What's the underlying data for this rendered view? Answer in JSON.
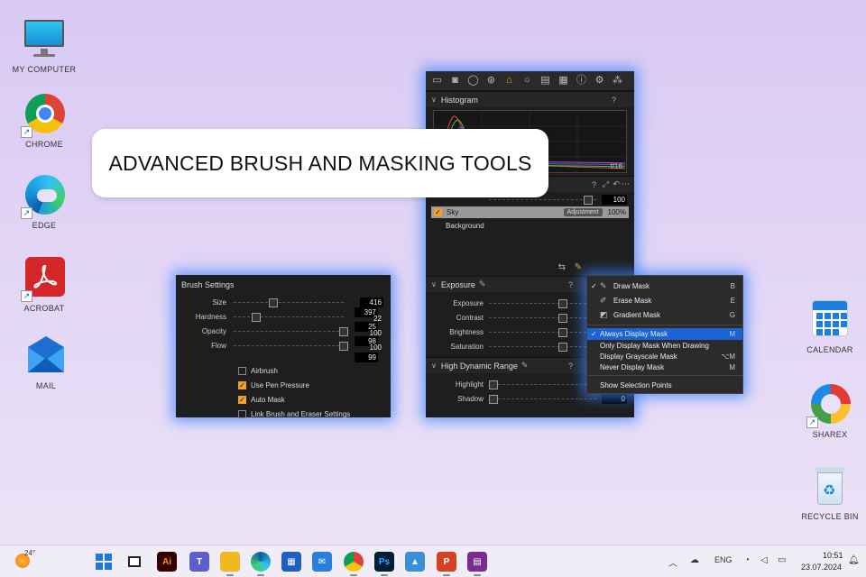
{
  "desktop": {
    "icons_left": [
      {
        "label": "MY COMPUTER",
        "icon": "monitor-icon"
      },
      {
        "label": "CHROME",
        "icon": "chrome-icon"
      },
      {
        "label": "EDGE",
        "icon": "edge-icon"
      },
      {
        "label": "ACROBAT",
        "icon": "acrobat-icon"
      },
      {
        "label": "MAIL",
        "icon": "mail-icon"
      }
    ],
    "icons_right": [
      {
        "label": "CALENDAR",
        "icon": "calendar-icon"
      },
      {
        "label": "SHAREX",
        "icon": "sharex-icon"
      },
      {
        "label": "RECYCLE BIN",
        "icon": "recycle-bin-icon"
      }
    ]
  },
  "banner": {
    "text": "ADVANCED BRUSH AND MASKING TOOLS"
  },
  "main_panel": {
    "histogram": {
      "title": "Histogram",
      "help": "?",
      "aperture": "f/16"
    },
    "layers": {
      "help": "?",
      "opacity_value": "100",
      "items": [
        {
          "name": "Sky",
          "badge": "Adjustment",
          "value": "100%",
          "checked": true
        },
        {
          "name": "Background"
        }
      ]
    },
    "exposure": {
      "title": "Exposure",
      "help": "?",
      "sliders": [
        {
          "name": "Exposure"
        },
        {
          "name": "Contrast"
        },
        {
          "name": "Brightness"
        },
        {
          "name": "Saturation"
        }
      ]
    },
    "hdr": {
      "title": "High Dynamic Range",
      "help": "?",
      "sliders": [
        {
          "name": "Highlight"
        },
        {
          "name": "Shadow",
          "value": "0"
        }
      ]
    }
  },
  "brush_settings": {
    "title": "Brush Settings",
    "sliders": [
      {
        "name": "Size",
        "value": "416"
      },
      {
        "name": "Hardness",
        "value": "397"
      },
      {
        "name": "Opacity",
        "value": "25"
      },
      {
        "name": "Flow",
        "value": "98"
      }
    ],
    "extra_values": [
      "22",
      "100",
      "100",
      "99"
    ],
    "options": [
      {
        "label": "Airbrush",
        "checked": false
      },
      {
        "label": "Use Pen Pressure",
        "checked": true
      },
      {
        "label": "Auto Mask",
        "checked": true
      },
      {
        "label": "Link Brush and Eraser Settings",
        "checked": false
      }
    ]
  },
  "mask_menu": {
    "tools": [
      {
        "label": "Draw Mask",
        "shortcut": "B",
        "checked": true
      },
      {
        "label": "Erase Mask",
        "shortcut": "E",
        "checked": false
      },
      {
        "label": "Gradient Mask",
        "shortcut": "G",
        "checked": false
      }
    ],
    "display": [
      {
        "label": "Always Display Mask",
        "shortcut": "M",
        "checked": true,
        "highlighted": true
      },
      {
        "label": "Only Display Mask When Drawing",
        "shortcut": ""
      },
      {
        "label": "Display Grayscale Mask",
        "shortcut": "⌥M"
      },
      {
        "label": "Never Display Mask",
        "shortcut": "M"
      }
    ],
    "extra": [
      {
        "label": "Show Selection Points"
      }
    ]
  },
  "taskbar": {
    "weather": "24°",
    "language": "ENG",
    "time": "10:51",
    "date": "23.07.2024"
  },
  "colors": {
    "accent_glow": "#3c82ff",
    "menu_highlight": "#1d63d6",
    "checkbox_on": "#f0a030"
  }
}
